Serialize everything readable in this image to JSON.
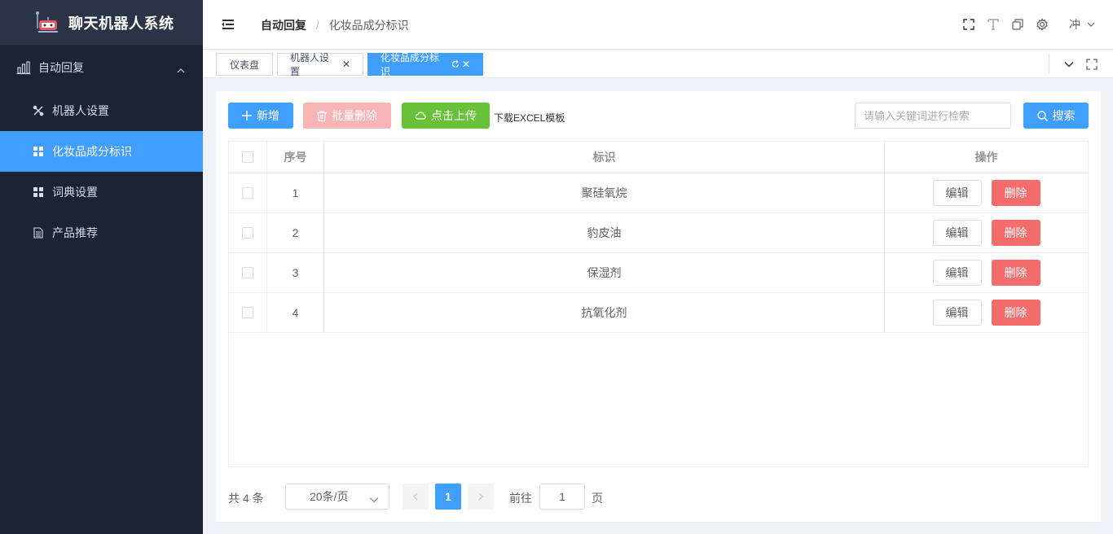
{
  "app": {
    "title": "聊天机器人系统"
  },
  "sidebar": {
    "group": {
      "label": "自动回复",
      "icon": "bar-chart-icon"
    },
    "items": [
      {
        "label": "机器人设置",
        "icon": "tools-icon",
        "active": false
      },
      {
        "label": "化妆品成分标识",
        "icon": "grid-icon",
        "active": true
      },
      {
        "label": "词典设置",
        "icon": "grid-icon",
        "active": false
      },
      {
        "label": "产品推荐",
        "icon": "document-icon",
        "active": false
      }
    ]
  },
  "header": {
    "breadcrumb": [
      "自动回复",
      "化妆品成分标识"
    ],
    "user": "冲"
  },
  "tabs": [
    {
      "label": "仪表盘",
      "closable": false,
      "active": false
    },
    {
      "label": "机器人设置",
      "closable": true,
      "active": false
    },
    {
      "label": "化妆品成分标识",
      "closable": true,
      "active": true
    }
  ],
  "toolbar": {
    "add_label": "新增",
    "batch_delete_label": "批量删除",
    "upload_label": "点击上传",
    "download_label": "下载EXCEL模板",
    "search_placeholder": "请输入关键词进行检索",
    "search_label": "搜索"
  },
  "table": {
    "headers": {
      "no": "序号",
      "mark": "标识",
      "op": "操作"
    },
    "rows": [
      {
        "no": "1",
        "mark": "聚硅氧烷"
      },
      {
        "no": "2",
        "mark": "豹皮油"
      },
      {
        "no": "3",
        "mark": "保湿剂"
      },
      {
        "no": "4",
        "mark": "抗氧化剂"
      }
    ],
    "edit_label": "编辑",
    "delete_label": "删除"
  },
  "pagination": {
    "total_text": "共 4 条",
    "page_size": "20条/页",
    "current_page": "1",
    "goto_label": "前往",
    "goto_value": "1",
    "page_suffix": "页"
  },
  "colors": {
    "sidebar_bg": "#1c2333",
    "primary": "#409eff",
    "success": "#67c23a",
    "danger": "#f56c6c"
  }
}
